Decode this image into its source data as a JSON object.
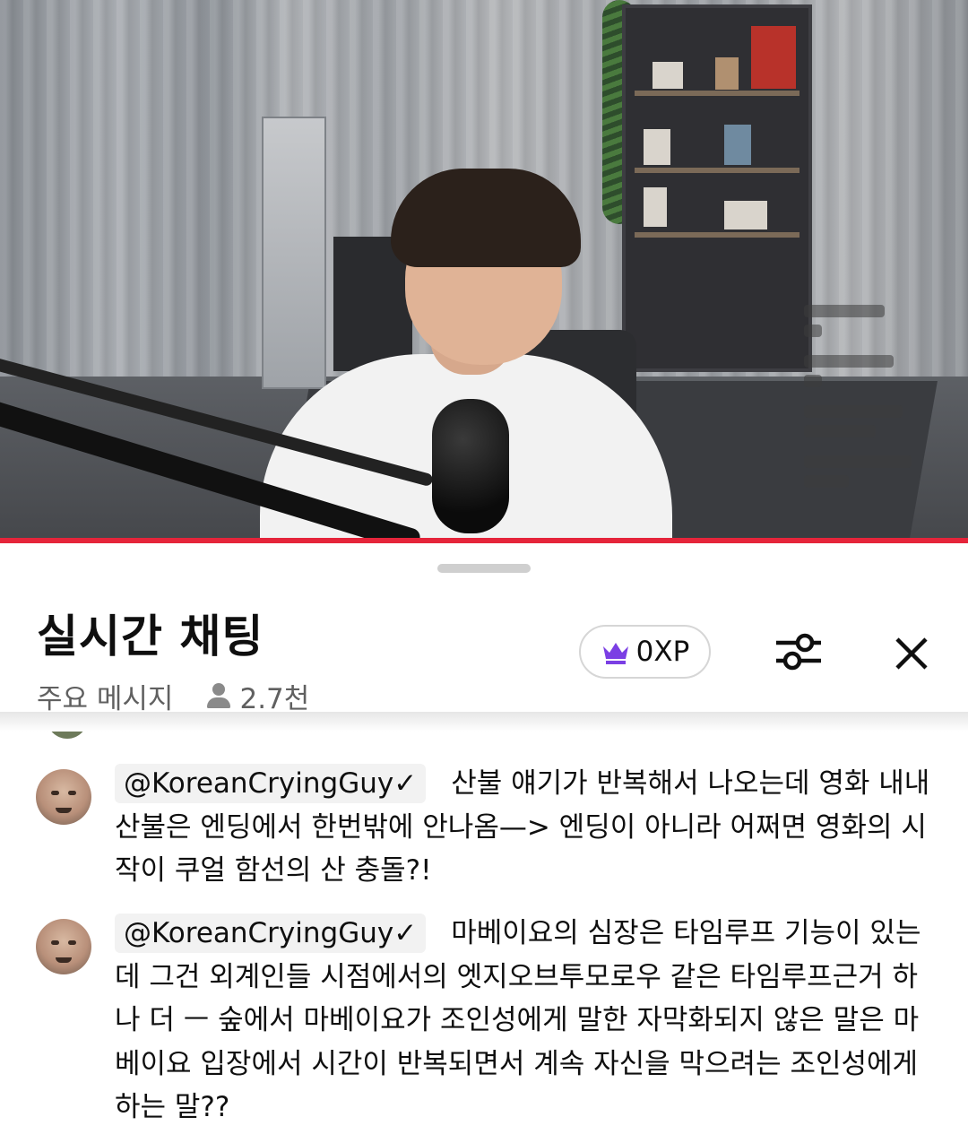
{
  "chat_panel": {
    "title": "실시간 채팅",
    "filter_label": "주요 메시지",
    "viewer_count": "2.7천",
    "xp_label": "0XP"
  },
  "icons": {
    "xp": "crown-icon",
    "settings": "sliders-icon",
    "close": "close-icon",
    "viewers": "person-icon"
  },
  "colors": {
    "progress": "#e5243a",
    "crown": "#7b3fe4"
  },
  "messages": [
    {
      "author": "@KoreanCryingGuy✓",
      "text": "산불 얘기가 반복해서 나오는데 영화 내내 산불은 엔딩에서 한번밖에 안나옴—> 엔딩이 아니라 어쩌면 영화의 시작이 쿠얼 함선의 산 충돌?!"
    },
    {
      "author": "@KoreanCryingGuy✓",
      "text": "마베이요의 심장은 타임루프 기능이 있는데 그건 외계인들 시점에서의 엣지오브투모로우 같은 타임루프근거 하나 더 ㅡ 숲에서 마베이요가 조인성에게 말한 자막화되지 않은 말은 마베이요 입장에서 시간이 반복되면서 계속 자신을 막으려는 조인성에게 하는 말??"
    }
  ]
}
